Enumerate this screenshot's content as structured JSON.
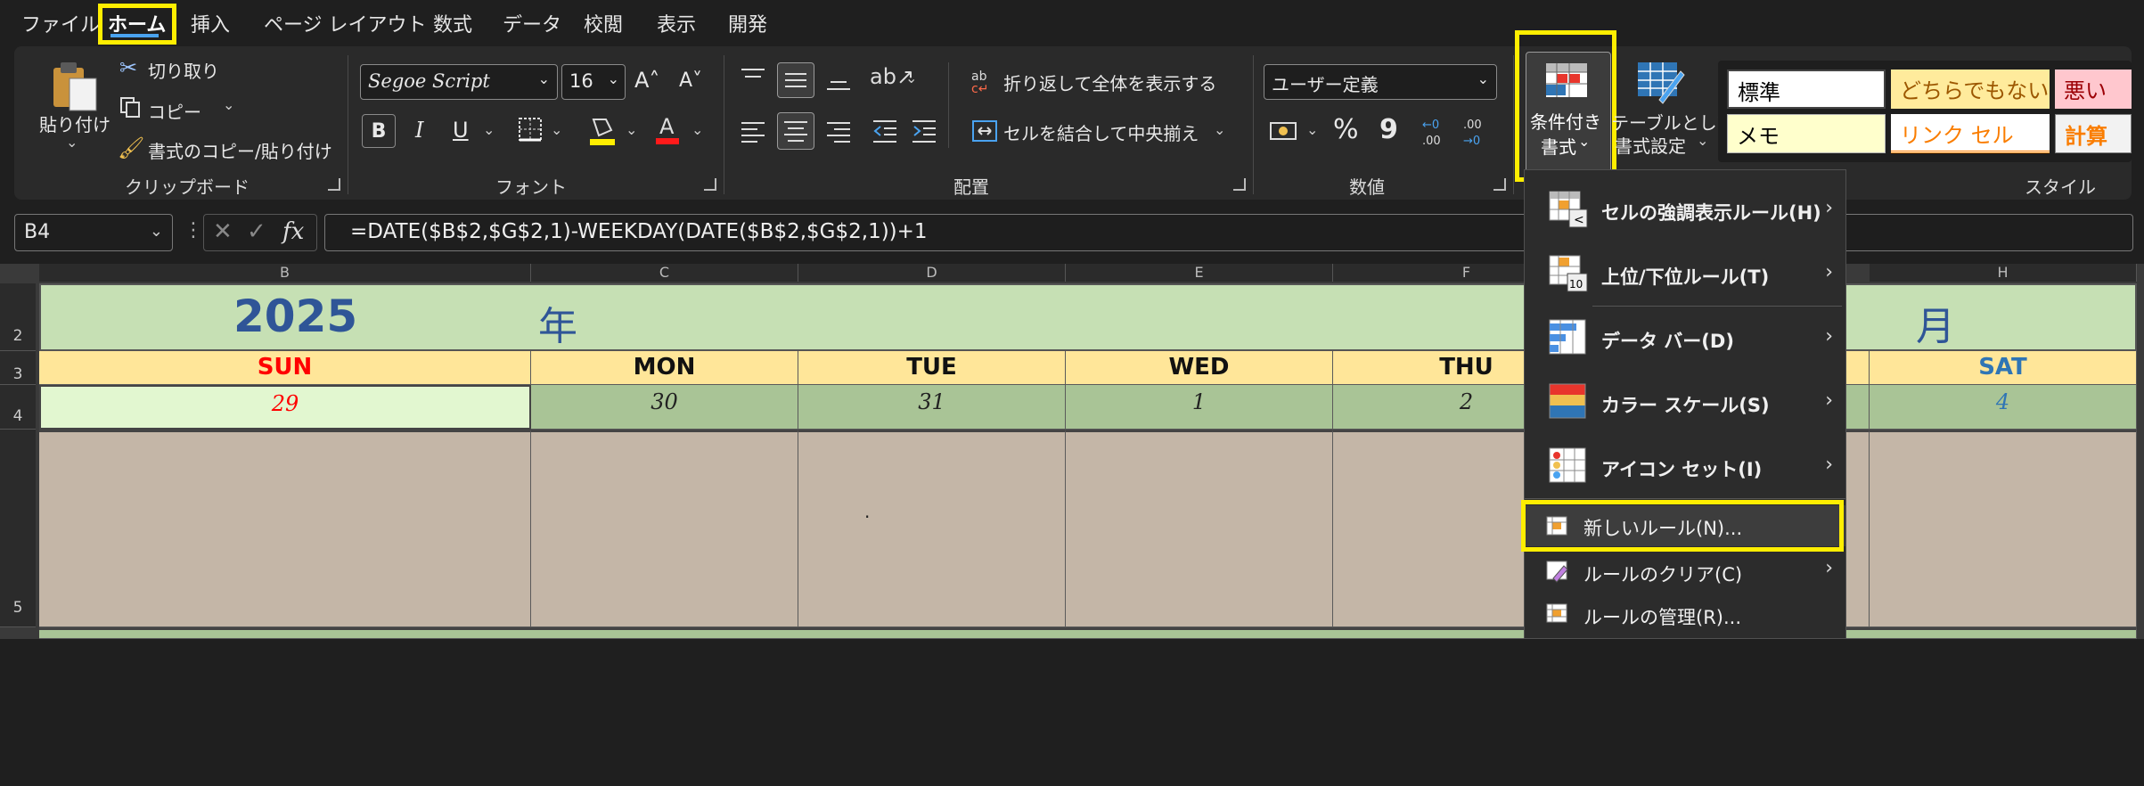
{
  "tabs": [
    "ファイル",
    "ホーム",
    "挿入",
    "ページ レイアウト",
    "数式",
    "データ",
    "校閲",
    "表示",
    "開発"
  ],
  "clipboard": {
    "paste": "貼り付け",
    "cut": "切り取り",
    "copy": "コピー",
    "format_painter": "書式のコピー/貼り付け",
    "label": "クリップボード"
  },
  "font": {
    "name": "Segoe Script",
    "size": "16",
    "bold": "B",
    "italic": "I",
    "underline": "U",
    "label": "フォント"
  },
  "alignment": {
    "wrap_text": "折り返して全体を表示する",
    "merge_center": "セルを結合して中央揃え",
    "label": "配置"
  },
  "number": {
    "format": "ユーザー定義",
    "percent": "%",
    "comma": "9",
    "label": "数値"
  },
  "styles_group": {
    "conditional_formatting": [
      "条件付き",
      "書式"
    ],
    "format_as_table": [
      "テーブルとして",
      "書式設定"
    ],
    "label": "スタイル",
    "cells": {
      "normal": "標準",
      "neutral": "どちらでもない",
      "bad": "悪い",
      "note": "メモ",
      "linked_cell": "リンク セル",
      "calculation": "計算"
    }
  },
  "formula_bar": {
    "name_box": "B4",
    "fx": "fx",
    "formula": "=DATE($B$2,$G$2,1)-WEEKDAY(DATE($B$2,$G$2,1))+1"
  },
  "sheet": {
    "columns": [
      "B",
      "C",
      "D",
      "E",
      "F",
      "H"
    ],
    "rows": [
      "2",
      "3",
      "4",
      "5"
    ],
    "year": "2025",
    "year_suffix": "年",
    "month_suffix": "月",
    "days": [
      "SUN",
      "MON",
      "TUE",
      "WED",
      "THU",
      "SAT"
    ],
    "dates": [
      "29",
      "30",
      "31",
      "1",
      "2",
      "4"
    ],
    "dot": "."
  },
  "cf_menu": {
    "items": [
      {
        "label": "セルの強調表示ルール(H)",
        "icon": "highlight-cells-rules-icon"
      },
      {
        "label": "上位/下位ルール(T)",
        "icon": "top-bottom-rules-icon"
      },
      {
        "label": "データ バー(D)",
        "icon": "data-bars-icon"
      },
      {
        "label": "カラー スケール(S)",
        "icon": "color-scales-icon"
      },
      {
        "label": "アイコン セット(I)",
        "icon": "icon-sets-icon"
      },
      {
        "label": "新しいルール(N)...",
        "icon": "new-rule-icon"
      },
      {
        "label": "ルールのクリア(C)",
        "icon": "clear-rules-icon"
      },
      {
        "label": "ルールの管理(R)...",
        "icon": "manage-rules-icon"
      }
    ],
    "topbottom_icon_text": "10"
  },
  "colors": {
    "highlight": "#ffee00",
    "header_green": "#c6e0b4",
    "day_yellow": "#ffe699",
    "date_green": "#a9c496",
    "sunday_date": "#e2f7d0",
    "body_tan": "#c4b6a7",
    "sunday_red": "#ff0000",
    "saturday_blue": "#2f75b5",
    "title_blue": "#2f5597"
  }
}
